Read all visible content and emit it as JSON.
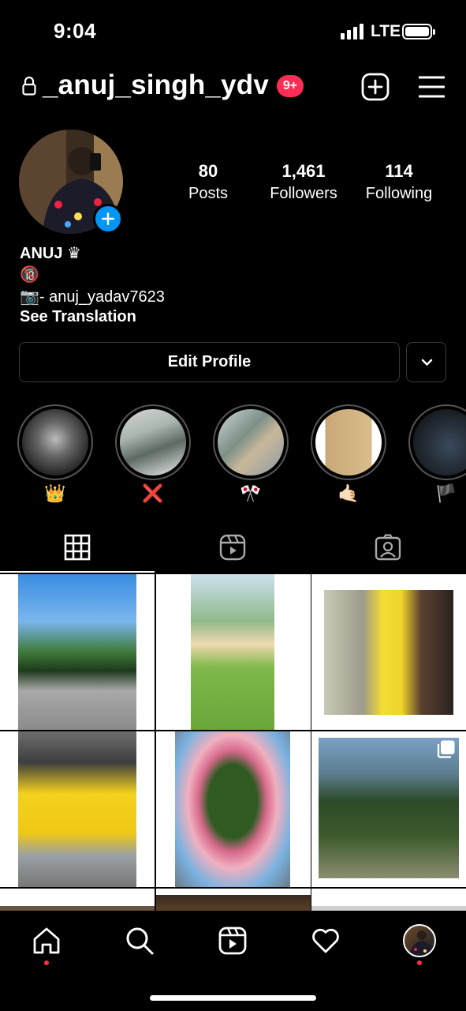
{
  "status_bar": {
    "time": "9:04",
    "network": "LTE"
  },
  "header": {
    "username": "_anuj_singh_ydv",
    "notification_badge": "9+"
  },
  "stats": [
    {
      "value": "80",
      "label": "Posts"
    },
    {
      "value": "1,461",
      "label": "Followers"
    },
    {
      "value": "114",
      "label": "Following"
    }
  ],
  "bio": {
    "name": "ANUJ ♛",
    "line1": "🔞",
    "line2": "📷- anuj_yadav7623",
    "see_translation": "See Translation"
  },
  "buttons": {
    "edit_profile": "Edit Profile"
  },
  "highlights": [
    {
      "label": "👑"
    },
    {
      "label": "❌"
    },
    {
      "label": "🎌"
    },
    {
      "label": "🤙🏻"
    },
    {
      "label": "🏴"
    }
  ],
  "tabs": [
    "grid-icon",
    "reels-icon",
    "tagged-icon"
  ],
  "nav": [
    "home-icon",
    "search-icon",
    "reels-icon",
    "heart-icon",
    "profile-avatar"
  ],
  "colors": {
    "accent_blue": "#0095f6",
    "badge_red": "#ff2d55",
    "background": "#000000"
  }
}
